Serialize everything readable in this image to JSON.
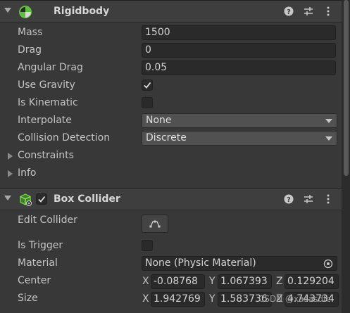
{
  "rigidbody": {
    "title": "Rigidbody",
    "fields": {
      "mass": {
        "label": "Mass",
        "value": "1500"
      },
      "drag": {
        "label": "Drag",
        "value": "0"
      },
      "angular_drag": {
        "label": "Angular Drag",
        "value": "0.05"
      },
      "use_gravity": {
        "label": "Use Gravity",
        "checked": true
      },
      "is_kinematic": {
        "label": "Is Kinematic",
        "checked": false
      },
      "interpolate": {
        "label": "Interpolate",
        "value": "None"
      },
      "collision_detection": {
        "label": "Collision Detection",
        "value": "Discrete"
      }
    },
    "foldouts": {
      "constraints": "Constraints",
      "info": "Info"
    }
  },
  "box_collider": {
    "title": "Box Collider",
    "enabled": true,
    "fields": {
      "edit_collider": {
        "label": "Edit Collider"
      },
      "is_trigger": {
        "label": "Is Trigger",
        "checked": false
      },
      "material": {
        "label": "Material",
        "value": "None (Physic Material)"
      },
      "center": {
        "label": "Center",
        "x": "-0.08768",
        "y": "1.067393",
        "z": "0.129204"
      },
      "size": {
        "label": "Size",
        "x": "1.942769",
        "y": "1.583736",
        "z": "4.743734"
      }
    }
  },
  "axis_labels": {
    "x": "X",
    "y": "Y",
    "z": "Z"
  },
  "watermark": "CSDN @xasasdfc",
  "icons": {
    "rigidbody": "rigidbody-icon",
    "box_collider": "box-collider-icon",
    "help": "help-icon",
    "presets": "presets-icon",
    "menu": "kebab-menu-icon"
  },
  "colors": {
    "background": "#383838",
    "header": "#3e3e3e",
    "field": "#2a2a2a",
    "dropdown": "#515151",
    "rigidbody_icon_green": "#5fbf3f"
  }
}
